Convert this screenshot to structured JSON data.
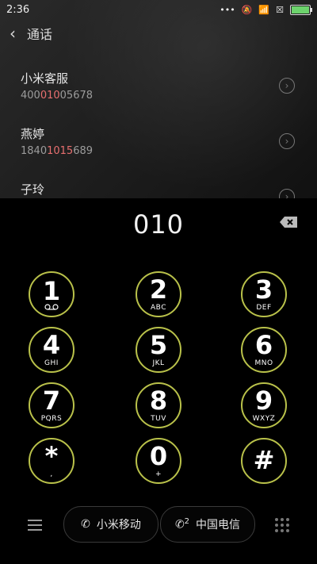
{
  "status": {
    "time": "2:36"
  },
  "header": {
    "title": "通话"
  },
  "contacts": [
    {
      "name": "小米客服",
      "num_before": "400",
      "num_hl": "010",
      "num_after": "05678"
    },
    {
      "name": "燕婷",
      "num_before": "1840",
      "num_hl": "1015",
      "num_after": "689"
    },
    {
      "name": "子玲",
      "num_before": "",
      "num_hl": "",
      "num_after": ""
    }
  ],
  "dialer": {
    "entered": "010",
    "keys": [
      {
        "digit": "1",
        "letters": "voicemail"
      },
      {
        "digit": "2",
        "letters": "ABC"
      },
      {
        "digit": "3",
        "letters": "DEF"
      },
      {
        "digit": "4",
        "letters": "GHI"
      },
      {
        "digit": "5",
        "letters": "JKL"
      },
      {
        "digit": "6",
        "letters": "MNO"
      },
      {
        "digit": "7",
        "letters": "PQRS"
      },
      {
        "digit": "8",
        "letters": "TUV"
      },
      {
        "digit": "9",
        "letters": "WXYZ"
      },
      {
        "digit": "*",
        "letters": ","
      },
      {
        "digit": "0",
        "letters": "+"
      },
      {
        "digit": "#",
        "letters": ""
      }
    ]
  },
  "bottom": {
    "sim1_label": "小米移动",
    "sim2_label": "中国电信",
    "sim2_index": "2"
  },
  "colors": {
    "ring": "#b9c14a",
    "highlight": "#e86f6f"
  },
  "icons": [
    "back-icon",
    "chevron-right-icon",
    "backspace-icon",
    "menu-icon",
    "phone-icon",
    "grid-icon"
  ]
}
